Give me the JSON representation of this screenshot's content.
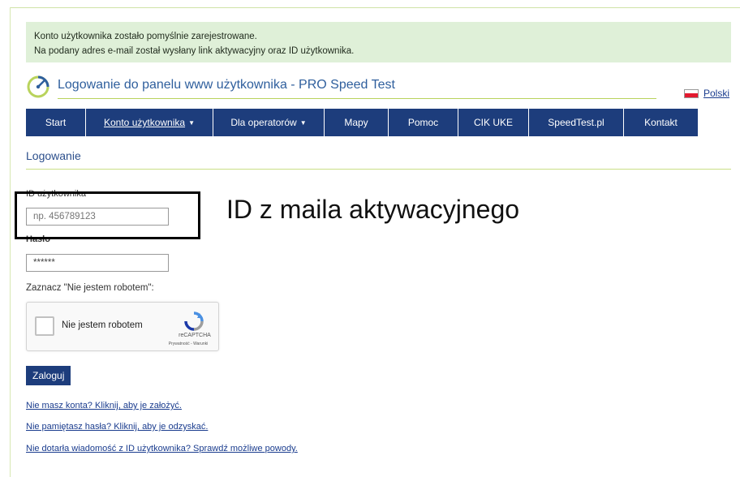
{
  "alert": {
    "line1": "Konto użytkownika zostało pomyślnie zarejestrowane.",
    "line2": "Na podany adres e-mail został wysłany link aktywacyjny oraz ID użytkownika."
  },
  "header": {
    "title": "Logowanie do panelu www użytkownika - PRO Speed Test",
    "language": "Polski"
  },
  "nav": {
    "items": [
      {
        "label": "Start"
      },
      {
        "label": "Konto użytkownika"
      },
      {
        "label": "Dla operatorów"
      },
      {
        "label": "Mapy"
      },
      {
        "label": "Pomoc"
      },
      {
        "label": "CIK UKE"
      },
      {
        "label": "SpeedTest.pl"
      },
      {
        "label": "Kontakt"
      }
    ]
  },
  "login": {
    "section_title": "Logowanie",
    "id_label": "ID użytkownika",
    "id_placeholder": "np. 456789123",
    "password_label": "Hasło",
    "password_value": "******",
    "captcha_label": "Zaznacz \"Nie jestem robotem\":",
    "captcha_checkbox_label": "Nie jestem robotem",
    "captcha_brand": "reCAPTCHA",
    "captcha_terms": "Prywatność - Warunki",
    "submit_label": "Zaloguj"
  },
  "annotation": {
    "text": "ID z maila aktywacyjnego"
  },
  "links": {
    "no_account": "Nie masz konta? Kliknij, aby je założyć.",
    "forgot_password": "Nie pamiętasz hasła? Kliknij, aby je odzyskać.",
    "no_message": "Nie dotarła wiadomość z ID użytkownika? Sprawdź możliwe powody."
  },
  "colors": {
    "nav_bg": "#1d3d7c",
    "alert_bg": "#dff0d8",
    "title_color": "#2f5f9d",
    "accent_line": "#b9d35c"
  },
  "icons": {
    "logo": "speedometer-icon",
    "flag": "polish-flag-icon",
    "captcha": "recaptcha-icon"
  }
}
